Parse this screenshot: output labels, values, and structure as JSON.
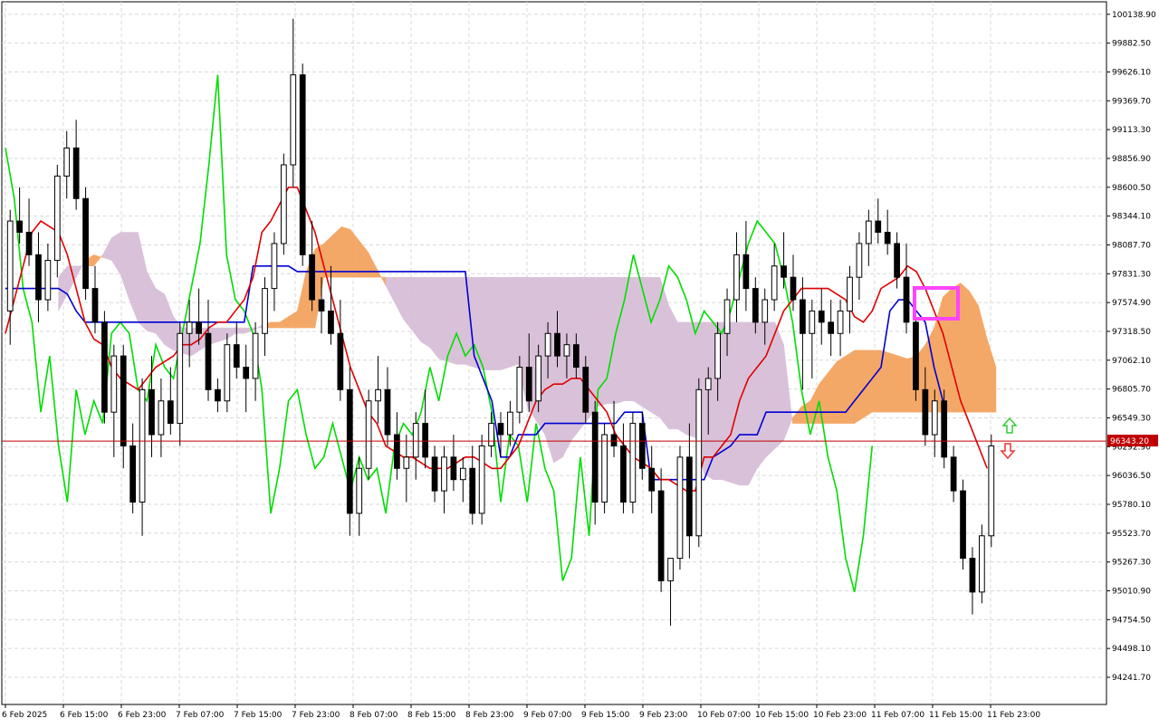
{
  "chart_data": {
    "type": "candlestick",
    "symbol": "BTCUSD",
    "timeframe": "H1",
    "y_axis": {
      "min": 94000,
      "max": 100250,
      "ticks": [
        "100138.90",
        "99882.50",
        "99626.10",
        "99369.70",
        "99113.30",
        "98856.90",
        "98600.50",
        "98344.10",
        "98087.70",
        "97831.30",
        "97574.90",
        "97318.50",
        "97062.10",
        "96805.70",
        "96549.30",
        "96292.90",
        "96036.50",
        "95780.10",
        "95523.70",
        "95267.30",
        "95010.90",
        "94754.50",
        "94498.10",
        "94241.70"
      ]
    },
    "x_axis": {
      "ticks": [
        "6 Feb 2025",
        "6 Feb 15:00",
        "6 Feb 23:00",
        "7 Feb 07:00",
        "7 Feb 15:00",
        "7 Feb 23:00",
        "8 Feb 07:00",
        "8 Feb 15:00",
        "8 Feb 23:00",
        "9 Feb 07:00",
        "9 Feb 15:00",
        "9 Feb 23:00",
        "10 Feb 07:00",
        "10 Feb 15:00",
        "10 Feb 23:00",
        "11 Feb 07:00",
        "11 Feb 15:00",
        "11 Feb 23:00"
      ]
    },
    "last_price": "96343.20",
    "candles": [
      [
        97500,
        98400,
        97200,
        98300
      ],
      [
        98300,
        98600,
        98100,
        98200
      ],
      [
        98200,
        98500,
        97900,
        98000
      ],
      [
        98000,
        98200,
        97400,
        97600
      ],
      [
        97600,
        98100,
        97500,
        97950
      ],
      [
        97950,
        98800,
        97800,
        98700
      ],
      [
        98700,
        99100,
        98500,
        98950
      ],
      [
        98950,
        99200,
        98400,
        98500
      ],
      [
        98500,
        98600,
        97600,
        97700
      ],
      [
        97700,
        97900,
        97300,
        97400
      ],
      [
        97400,
        97500,
        96500,
        96600
      ],
      [
        96600,
        97200,
        96200,
        97100
      ],
      [
        97100,
        97200,
        96100,
        96300
      ],
      [
        96300,
        96500,
        95700,
        95800
      ],
      [
        95800,
        96900,
        95500,
        96800
      ],
      [
        96800,
        97100,
        96200,
        96400
      ],
      [
        96400,
        96900,
        96200,
        96700
      ],
      [
        96700,
        97000,
        96400,
        96500
      ],
      [
        96500,
        97400,
        96300,
        97300
      ],
      [
        97300,
        97600,
        97000,
        97400
      ],
      [
        97400,
        97700,
        97200,
        97300
      ],
      [
        97300,
        97600,
        96700,
        96800
      ],
      [
        96800,
        96900,
        96600,
        96700
      ],
      [
        96700,
        97300,
        96600,
        97200
      ],
      [
        97200,
        97400,
        96900,
        97000
      ],
      [
        97000,
        97200,
        96600,
        96900
      ],
      [
        96900,
        97400,
        96700,
        97300
      ],
      [
        97300,
        97800,
        97100,
        97700
      ],
      [
        97700,
        98200,
        97500,
        98100
      ],
      [
        98100,
        98900,
        98000,
        98800
      ],
      [
        98800,
        100100,
        98600,
        99600
      ],
      [
        99600,
        99700,
        97900,
        98000
      ],
      [
        98000,
        98300,
        97500,
        97600
      ],
      [
        97600,
        97800,
        97300,
        97500
      ],
      [
        97500,
        97900,
        97200,
        97300
      ],
      [
        97300,
        97600,
        96700,
        96800
      ],
      [
        96800,
        97000,
        95500,
        95700
      ],
      [
        95700,
        96200,
        95500,
        96100
      ],
      [
        96100,
        96800,
        96000,
        96700
      ],
      [
        96700,
        97100,
        96500,
        96800
      ],
      [
        96800,
        97000,
        96300,
        96400
      ],
      [
        96400,
        96600,
        96000,
        96100
      ],
      [
        96100,
        96400,
        95800,
        96200
      ],
      [
        96200,
        96600,
        96000,
        96500
      ],
      [
        96500,
        96800,
        96100,
        96200
      ],
      [
        96200,
        96300,
        95800,
        95900
      ],
      [
        95900,
        96300,
        95700,
        96200
      ],
      [
        96200,
        96400,
        95900,
        96000
      ],
      [
        96000,
        96200,
        95800,
        96100
      ],
      [
        96100,
        96300,
        95600,
        95700
      ],
      [
        95700,
        96400,
        95600,
        96300
      ],
      [
        96300,
        96600,
        96200,
        96500
      ],
      [
        96500,
        96600,
        96200,
        96400
      ],
      [
        96400,
        96700,
        96300,
        96600
      ],
      [
        96600,
        97100,
        96500,
        97000
      ],
      [
        97000,
        97300,
        96600,
        96700
      ],
      [
        96700,
        97200,
        96600,
        97100
      ],
      [
        97100,
        97400,
        96900,
        97300
      ],
      [
        97300,
        97500,
        97000,
        97100
      ],
      [
        97100,
        97300,
        96900,
        97200
      ],
      [
        97200,
        97300,
        96900,
        97000
      ],
      [
        97000,
        97100,
        96500,
        96600
      ],
      [
        96600,
        96700,
        95600,
        95800
      ],
      [
        95800,
        96500,
        95700,
        96400
      ],
      [
        96400,
        96700,
        96200,
        96300
      ],
      [
        96300,
        96500,
        95700,
        95800
      ],
      [
        95800,
        96600,
        95700,
        96500
      ],
      [
        96500,
        96600,
        96000,
        96100
      ],
      [
        96100,
        96300,
        95700,
        95900
      ],
      [
        95900,
        96100,
        95000,
        95100
      ],
      [
        95100,
        95300,
        94700,
        95300
      ],
      [
        95300,
        96300,
        95200,
        96200
      ],
      [
        96200,
        96500,
        95300,
        95500
      ],
      [
        95500,
        96900,
        95400,
        96800
      ],
      [
        96800,
        97000,
        96400,
        96900
      ],
      [
        96900,
        97400,
        96700,
        97300
      ],
      [
        97300,
        97700,
        97100,
        97600
      ],
      [
        97600,
        98200,
        97400,
        98000
      ],
      [
        98000,
        98300,
        97500,
        97700
      ],
      [
        97700,
        97800,
        97300,
        97400
      ],
      [
        97400,
        97700,
        97200,
        97600
      ],
      [
        97600,
        98100,
        97500,
        97900
      ],
      [
        97900,
        98200,
        97700,
        97800
      ],
      [
        97800,
        98000,
        97500,
        97600
      ],
      [
        97600,
        97800,
        96800,
        97300
      ],
      [
        97300,
        97600,
        96900,
        97500
      ],
      [
        97500,
        97700,
        97200,
        97400
      ],
      [
        97400,
        97600,
        97100,
        97300
      ],
      [
        97300,
        97600,
        97100,
        97500
      ],
      [
        97500,
        97900,
        97300,
        97800
      ],
      [
        97800,
        98200,
        97600,
        98100
      ],
      [
        98100,
        98400,
        97900,
        98300
      ],
      [
        98300,
        98500,
        98100,
        98200
      ],
      [
        98200,
        98400,
        98000,
        98100
      ],
      [
        98100,
        98200,
        97700,
        97800
      ],
      [
        97800,
        98100,
        97300,
        97400
      ],
      [
        97400,
        97600,
        96700,
        96800
      ],
      [
        96800,
        97000,
        96300,
        96400
      ],
      [
        96400,
        96800,
        96200,
        96700
      ],
      [
        96700,
        96800,
        96100,
        96200
      ],
      [
        96200,
        96300,
        95800,
        95900
      ],
      [
        95900,
        96000,
        95200,
        95300
      ],
      [
        95300,
        95400,
        94800,
        95000
      ],
      [
        95000,
        95600,
        94900,
        95500
      ],
      [
        95500,
        96400,
        95400,
        96300
      ]
    ],
    "series": [
      {
        "name": "tenkan",
        "color": "#e00000"
      },
      {
        "name": "kijun",
        "color": "#0000d0"
      },
      {
        "name": "chikou",
        "color": "#00dd00"
      },
      {
        "name": "senkou_bull",
        "color": "#f4a460"
      },
      {
        "name": "senkou_bear",
        "color": "#d8bfd8"
      }
    ],
    "tenkan": [
      97300,
      97600,
      97900,
      98200,
      98300,
      98250,
      98200,
      98000,
      97700,
      97400,
      97250,
      97200,
      97000,
      96900,
      96850,
      96800,
      96900,
      97000,
      97050,
      97100,
      97200,
      97200,
      97250,
      97350,
      97400,
      97400,
      97500,
      97600,
      97800,
      98200,
      98300,
      98450,
      98600,
      98600,
      98400,
      98200,
      97900,
      97600,
      97300,
      97000,
      96800,
      96600,
      96500,
      96300,
      96250,
      96200,
      96200,
      96150,
      96100,
      96100,
      96100,
      96150,
      96200,
      96200,
      96150,
      96100,
      96100,
      96200,
      96300,
      96500,
      96700,
      96800,
      96850,
      96850,
      96900,
      96900,
      96800,
      96700,
      96600,
      96400,
      96300,
      96200,
      96150,
      96100,
      96000,
      96000,
      95950,
      95900,
      95900,
      96200,
      96200,
      96300,
      96400,
      96700,
      96900,
      97000,
      97100,
      97300,
      97500,
      97600,
      97700,
      97700,
      97700,
      97700,
      97650,
      97600,
      97450,
      97400,
      97500,
      97700,
      97750,
      97800,
      97900,
      97850,
      97700,
      97500,
      97300,
      97000,
      96700,
      96500,
      96300,
      96100
    ],
    "kijun": [
      97700,
      97700,
      97700,
      97700,
      97700,
      97700,
      97700,
      97650,
      97500,
      97400,
      97400,
      97400,
      97400,
      97400,
      97400,
      97400,
      97400,
      97400,
      97400,
      97400,
      97400,
      97400,
      97400,
      97400,
      97400,
      97400,
      97400,
      97400,
      97900,
      97900,
      97900,
      97900,
      97900,
      97850,
      97850,
      97850,
      97850,
      97850,
      97850,
      97850,
      97850,
      97850,
      97850,
      97850,
      97850,
      97850,
      97850,
      97850,
      97850,
      97850,
      97850,
      97850,
      97850,
      97100,
      96900,
      96700,
      96200,
      96200,
      96400,
      96400,
      96400,
      96500,
      96500,
      96500,
      96500,
      96500,
      96500,
      96500,
      96500,
      96500,
      96600,
      96600,
      96600,
      96000,
      96000,
      96000,
      96000,
      96000,
      96000,
      96000,
      96200,
      96250,
      96300,
      96400,
      96400,
      96400,
      96600,
      96600,
      96600,
      96600,
      96600,
      96600,
      96600,
      96600,
      96600,
      96600,
      96700,
      96800,
      96900,
      97000,
      97500,
      97600,
      97600,
      97500,
      97400,
      97000,
      96700
    ]
  },
  "ui": {
    "price_box_color": "#c00000",
    "highlight_box_color": "#ff44ff",
    "arrow_up_color": "#33cc33",
    "arrow_down_color": "#ee3333"
  }
}
